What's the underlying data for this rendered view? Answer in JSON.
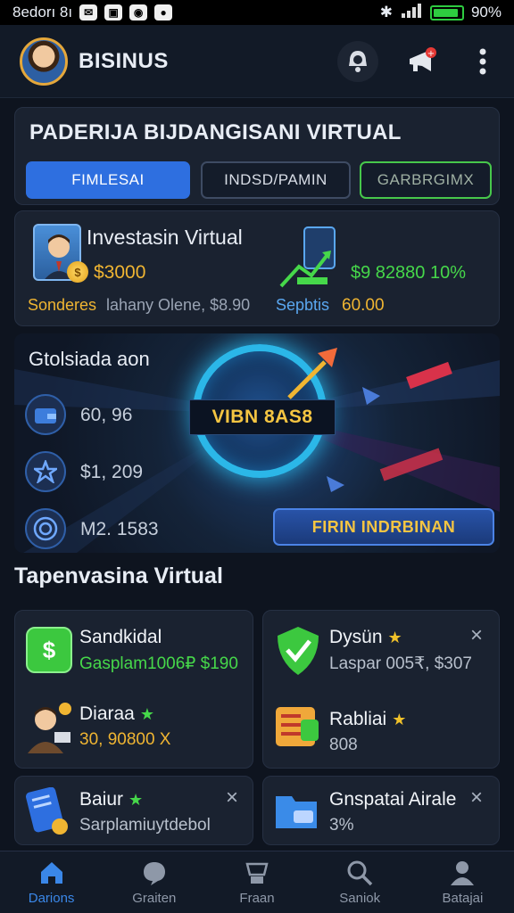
{
  "status_bar": {
    "time": "8edorı 8ı",
    "battery": "90%",
    "battery_level": 0.9
  },
  "header": {
    "title": "BISINUS"
  },
  "promo": {
    "title": "PADERIJA BIJDANGISANI VIRTUAL",
    "tabs": [
      {
        "label": "FIMLESAI"
      },
      {
        "label": "INDSD/PAMIN"
      },
      {
        "label": "GARBRGIMX"
      }
    ]
  },
  "investment": {
    "title": "Investasin Virtual",
    "amount": "$3000",
    "sub_label": "Sonderes",
    "sub_text": "lahany Olene, $8.90",
    "gain": "$9 82880 10%",
    "stat_label": "Sepbtis",
    "stat_value": "60.00"
  },
  "hero": {
    "title": "Gtolsiada aon",
    "badge": "VIBN 8AS8",
    "stats": [
      "60, 96",
      "$1, 209",
      "M2. 1583"
    ],
    "cta": "FIRIN  INDRBINAN"
  },
  "section": {
    "title": "Tapenvasina Virtual"
  },
  "apps": [
    {
      "name": "Sandkidal",
      "sub": "Gasplam1006₽ $190",
      "icon_glyph": "$"
    },
    {
      "name": "Dysün",
      "sub": "Laspar 005₹, $307"
    },
    {
      "name": "Diaraa",
      "sub": "30, 90800 X"
    },
    {
      "name": "Rabliai",
      "sub": "808"
    },
    {
      "name": "Baiur",
      "sub": "Sarplamiuytdebol"
    },
    {
      "name": "Gnspatai Airale",
      "sub": "3%"
    }
  ],
  "nav": {
    "items": [
      {
        "label": "Darions"
      },
      {
        "label": "Graiten"
      },
      {
        "label": "Fraan"
      },
      {
        "label": "Saniok"
      },
      {
        "label": "Batajai"
      }
    ]
  },
  "colors": {
    "accent": "#2e6fe0",
    "success": "#46d84a",
    "gold": "#f0b532",
    "background": "#0e141f"
  }
}
